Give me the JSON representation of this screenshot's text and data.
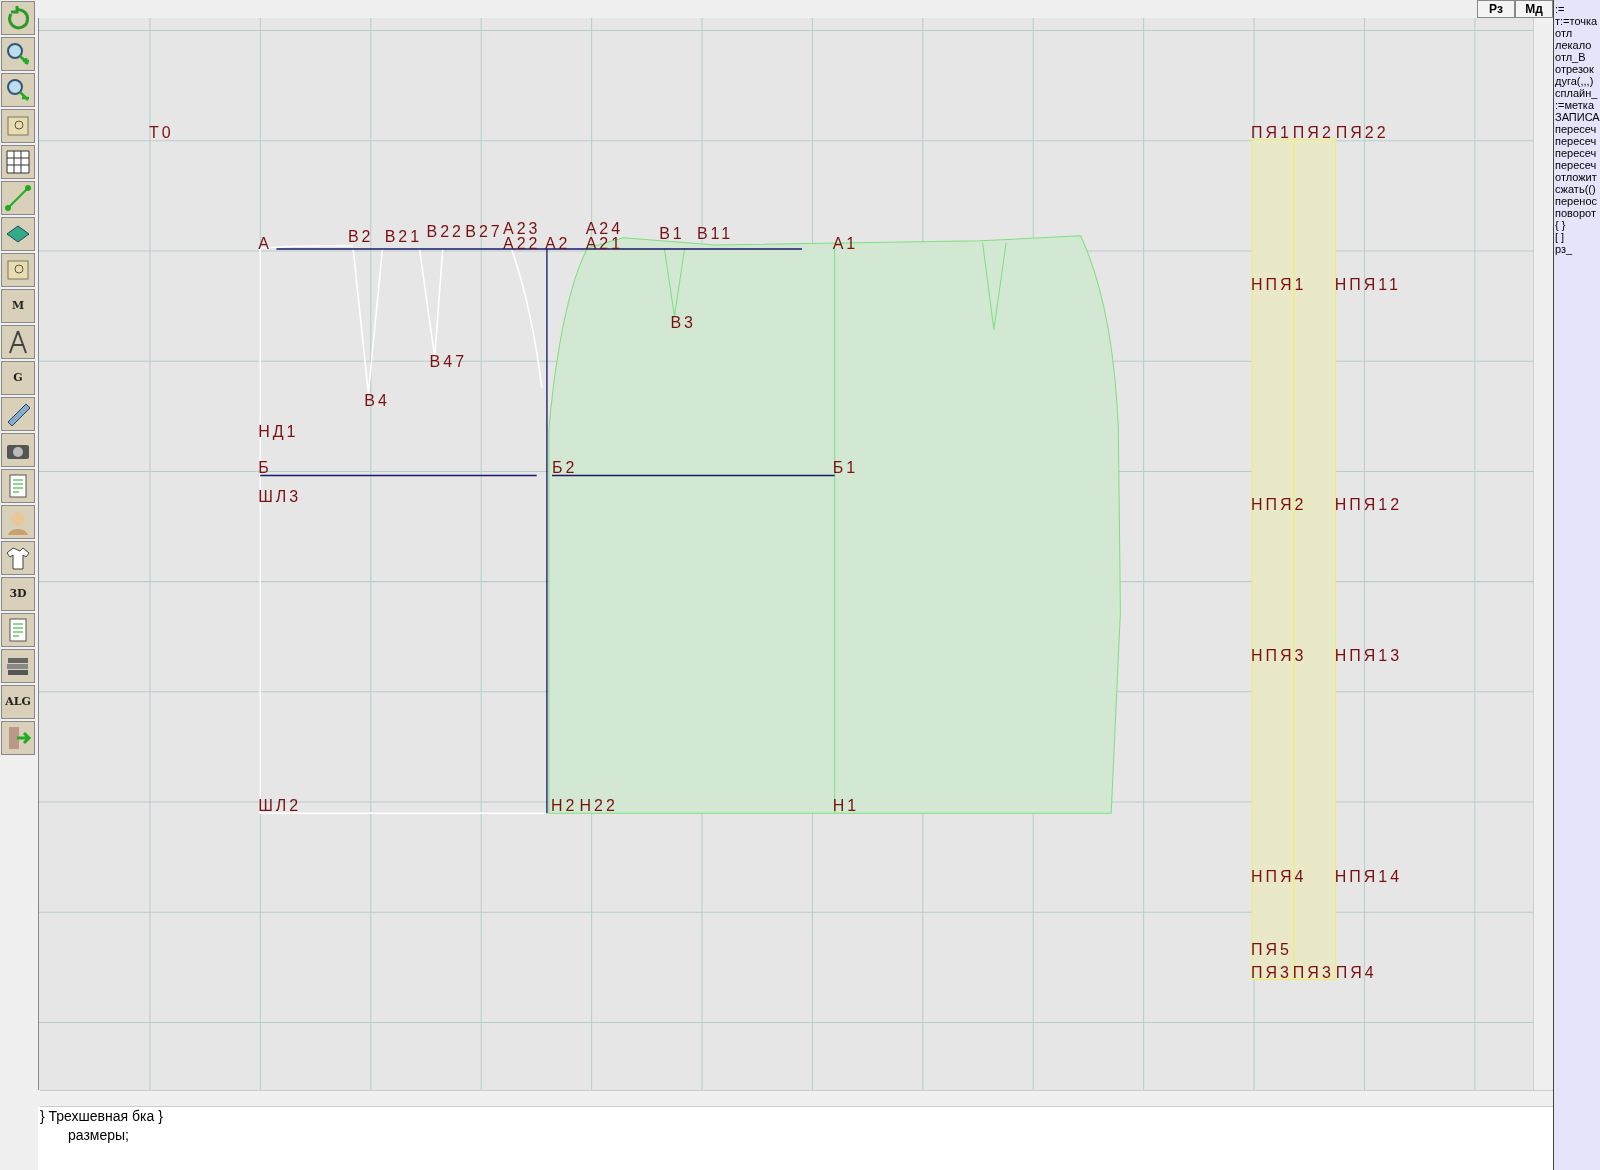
{
  "top_buttons": [
    "Рз",
    "Мд"
  ],
  "toolbar": [
    {
      "kind": "refresh"
    },
    {
      "kind": "zoom-in"
    },
    {
      "kind": "zoom-out"
    },
    {
      "kind": "map"
    },
    {
      "kind": "grid"
    },
    {
      "kind": "line"
    },
    {
      "kind": "layer"
    },
    {
      "kind": "map"
    },
    {
      "kind": "badge",
      "badge": "M"
    },
    {
      "kind": "compass"
    },
    {
      "kind": "badge",
      "badge": "G"
    },
    {
      "kind": "ruler"
    },
    {
      "kind": "camera"
    },
    {
      "kind": "sheet"
    },
    {
      "kind": "person"
    },
    {
      "kind": "shirt"
    },
    {
      "kind": "badge",
      "badge": "3D"
    },
    {
      "kind": "sheet"
    },
    {
      "kind": "books"
    },
    {
      "kind": "badge",
      "badge": "ALG"
    },
    {
      "kind": "exit"
    }
  ],
  "labels": [
    "Т0",
    "А",
    "В2",
    "В21",
    "В22",
    "В27",
    "А23",
    "А22",
    "А2",
    "А24",
    "А21",
    "В1",
    "В11",
    "А1",
    "В3",
    "В47",
    "В4",
    "НД1",
    "Б",
    "Б2",
    "Б1",
    "ШЛ3",
    "ШЛ2",
    "Н2",
    "Н22",
    "Н1",
    "ПЯ1",
    "ПЯ2",
    "ПЯ22",
    "НПЯ1",
    "НПЯ11",
    "НПЯ2",
    "НПЯ12",
    "НПЯ3",
    "НПЯ13",
    "НПЯ4",
    "НПЯ14",
    "ПЯ5",
    "ПЯ3",
    "ПЯ3",
    "ПЯ4"
  ],
  "commands": [
    ":=",
    "т:=точка",
    "отл",
    "лекало",
    "отл_В",
    "отрезок",
    "дуга(,,,)",
    "сплайн_",
    ":=метка",
    "ЗАПИСА",
    "пересеч",
    "пересеч",
    "пересеч",
    "пересеч",
    "отложит",
    "сжать(()",
    "перенос",
    "поворот",
    "{ }",
    "[ ]",
    "рз_"
  ],
  "editor_lines": [
    "} Трехшевная бка }",
    "размеры;"
  ]
}
